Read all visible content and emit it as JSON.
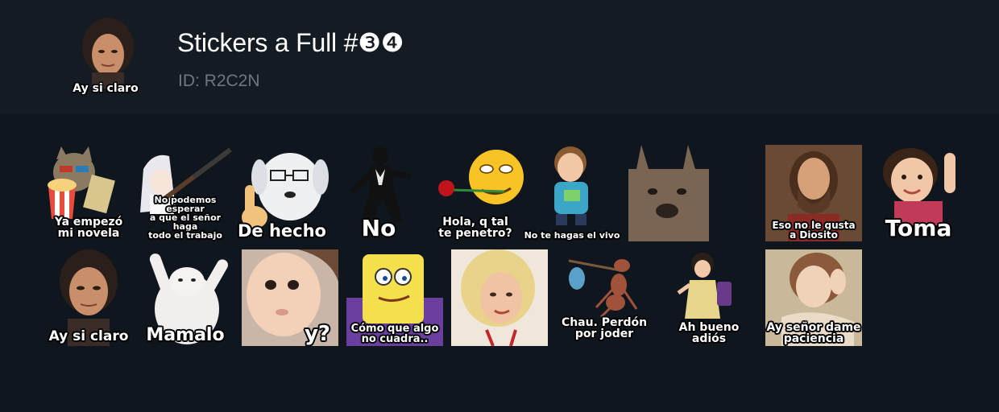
{
  "header": {
    "title": "Stickers a Full #❸❹",
    "id_text": "ID: R2C2N",
    "icon_caption": "Ay si claro"
  },
  "stickers": [
    {
      "caption": "Ya empezó\nmi novela",
      "icon": "cat-popcorn-icon"
    },
    {
      "caption": "No podemos esperar\na que el señor haga\ntodo el trabajo",
      "icon": "anime-girl-shotgun-icon"
    },
    {
      "caption": "De hecho",
      "icon": "dog-glasses-icon"
    },
    {
      "caption": "No",
      "icon": "spider-man-icon"
    },
    {
      "caption": "Hola, q tal\nte penetro?",
      "icon": "emoji-rose-icon"
    },
    {
      "caption": "No te hagas el vivo",
      "icon": "kid-icon"
    },
    {
      "caption": "",
      "icon": "dog-face-icon"
    },
    {
      "caption": "Eso no le gusta\na Diosito",
      "icon": "jesus-icon"
    },
    {
      "caption": "Toma",
      "icon": "baby-girl-icon"
    },
    {
      "caption": "Ay si claro",
      "icon": "woman-face-icon"
    },
    {
      "caption": "Mamalo",
      "icon": "cat-paws-icon"
    },
    {
      "caption": "y?",
      "icon": "baby-face-icon"
    },
    {
      "caption": "Cómo que algo\nno cuadra..",
      "icon": "spongebob-icon"
    },
    {
      "caption": "",
      "icon": "blonde-woman-icon"
    },
    {
      "caption": "Chau. Perdón\npor joder",
      "icon": "ant-bindle-icon"
    },
    {
      "caption": "Ah bueno adiós",
      "icon": "toddler-bag-icon"
    },
    {
      "caption": "Ay señor dame\npaciencia",
      "icon": "painting-woman-icon"
    }
  ]
}
